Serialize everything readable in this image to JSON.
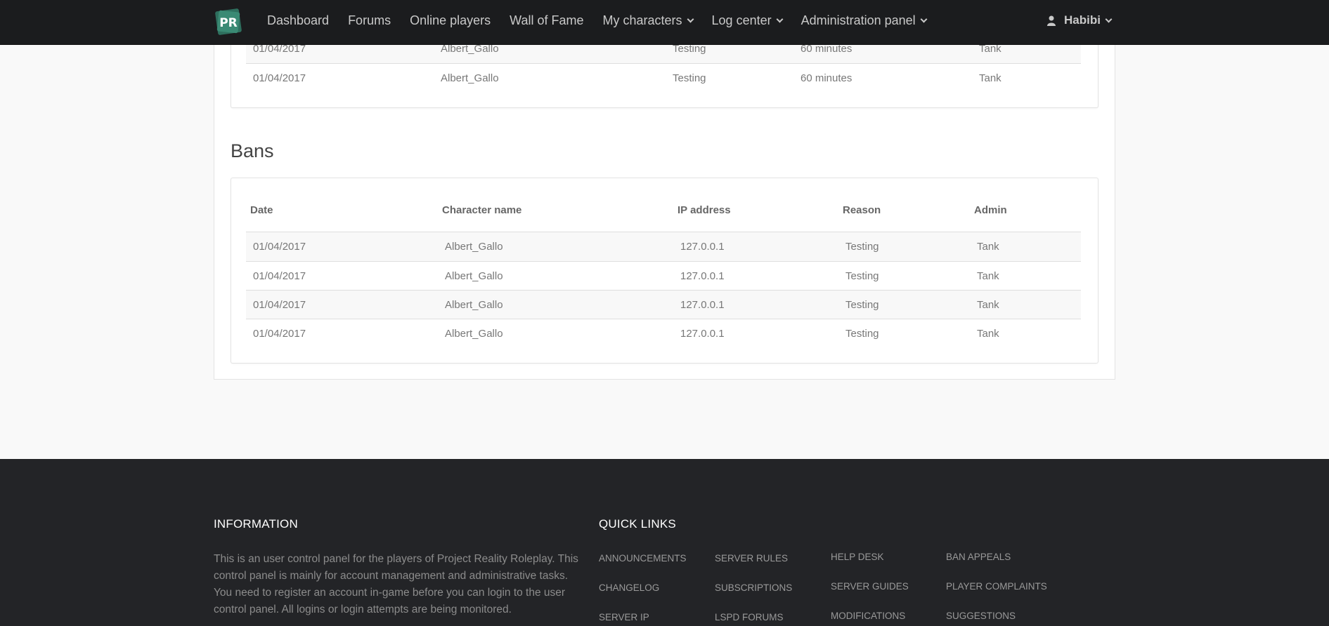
{
  "nav": {
    "items": [
      "Dashboard",
      "Forums",
      "Online players",
      "Wall of Fame",
      "My characters",
      "Log center",
      "Administration panel"
    ],
    "user": "Habibi"
  },
  "kicks_table": {
    "rows": [
      [
        "01/04/2017",
        "Albert_Gallo",
        "Testing",
        "60 minutes",
        "Tank"
      ],
      [
        "01/04/2017",
        "Albert_Gallo",
        "Testing",
        "60 minutes",
        "Tank"
      ]
    ]
  },
  "bans": {
    "title": "Bans",
    "headers": [
      "Date",
      "Character name",
      "IP address",
      "Reason",
      "Admin"
    ],
    "rows": [
      [
        "01/04/2017",
        "Albert_Gallo",
        "127.0.0.1",
        "Testing",
        "Tank"
      ],
      [
        "01/04/2017",
        "Albert_Gallo",
        "127.0.0.1",
        "Testing",
        "Tank"
      ],
      [
        "01/04/2017",
        "Albert_Gallo",
        "127.0.0.1",
        "Testing",
        "Tank"
      ],
      [
        "01/04/2017",
        "Albert_Gallo",
        "127.0.0.1",
        "Testing",
        "Tank"
      ]
    ]
  },
  "footer": {
    "info_title": "INFORMATION",
    "info_text": "This is an user control panel for the players of Project Reality Roleplay. This control panel is mainly for account management and administrative tasks. You need to register an account in-game before you can login to the user control panel. All logins or login attempts are being monitored.",
    "links_title": "QUICK LINKS",
    "links": [
      [
        "ANNOUNCEMENTS",
        "CHANGELOG",
        "SERVER IP"
      ],
      [
        "SERVER RULES",
        "SUBSCRIPTIONS",
        "LSPD FORUMS"
      ],
      [
        "HELP DESK",
        "SERVER GUIDES",
        "MODIFICATIONS"
      ],
      [
        "BAN APPEALS",
        "PLAYER COMPLAINTS",
        "SUGGESTIONS"
      ]
    ]
  },
  "colors": {
    "navbar_bg": "#1b1c1e",
    "footer_bg": "#232427",
    "logo_green": "#2e6f5e"
  }
}
